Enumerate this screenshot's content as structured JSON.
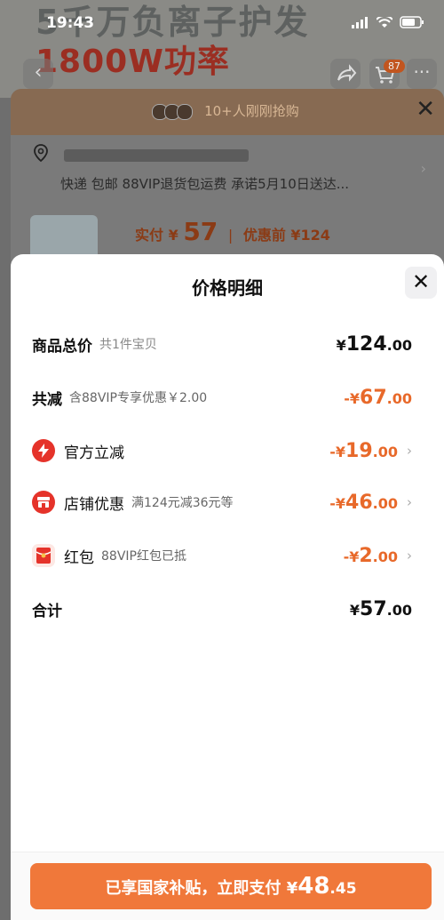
{
  "status": {
    "time": "19:43"
  },
  "hero": {
    "line1": "5千万负离子护发",
    "line2": "1800W功率"
  },
  "header": {
    "cart_badge": "87"
  },
  "background": {
    "buyers_text": "10+人刚刚抢购",
    "shipping_text": "快递 包邮 88VIP退货包运费 承诺5月10日送达...",
    "price_label": "实付",
    "price_currency": "¥",
    "price_value": "57",
    "price_before": "优惠前 ¥124"
  },
  "sheet": {
    "title": "价格明细",
    "rows": [
      {
        "label": "商品总价",
        "sub": "共1件宝贝",
        "currency": "¥",
        "integer": "124",
        "decimal": ".00"
      },
      {
        "label": "共减",
        "sub": "含88VIP专享优惠￥2.00",
        "currency": "-¥",
        "integer": "67",
        "decimal": ".00"
      },
      {
        "label": "官方立减",
        "sub": "",
        "currency": "-¥",
        "integer": "19",
        "decimal": ".00"
      },
      {
        "label": "店铺优惠",
        "sub": "满124元减36元等",
        "currency": "-¥",
        "integer": "46",
        "decimal": ".00"
      },
      {
        "label": "红包",
        "sub": "88VIP红包已抵",
        "currency": "-¥",
        "integer": "2",
        "decimal": ".00"
      },
      {
        "label": "合计",
        "sub": "",
        "currency": "¥",
        "integer": "57",
        "decimal": ".00"
      }
    ]
  },
  "pay_button": {
    "text": "已享国家补贴，立即支付 ¥",
    "integer": "48",
    "decimal": ".45"
  },
  "colors": {
    "accent": "#f0783a",
    "discount": "#e8692a",
    "icon_red": "#e5332a"
  },
  "icons": [
    "lightning-icon",
    "store-icon",
    "red-envelope-icon",
    "close-icon",
    "chevron-right-icon",
    "location-icon"
  ]
}
